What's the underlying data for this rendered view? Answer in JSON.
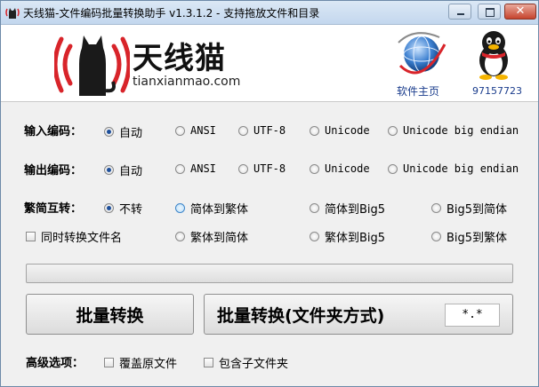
{
  "window": {
    "title": "天线猫-文件编码批量转换助手 v1.3.1.2 - 支持拖放文件和目录",
    "close_glyph": "✕"
  },
  "header": {
    "brand_name": "天线猫",
    "brand_url": "tianxianmao.com",
    "home_link": "软件主页",
    "qq_number": "97157723",
    "icons": [
      "cat-antenna-logo-icon",
      "globe-icon",
      "qq-penguin-icon"
    ]
  },
  "input_encoding": {
    "label": "输入编码：",
    "options": [
      "自动",
      "ANSI",
      "UTF-8",
      "Unicode",
      "Unicode big endian"
    ],
    "selected": "自动"
  },
  "output_encoding": {
    "label": "输出编码：",
    "options": [
      "自动",
      "ANSI",
      "UTF-8",
      "Unicode",
      "Unicode big endian"
    ],
    "selected": "自动"
  },
  "conversion": {
    "label": "繁简互转：",
    "options": [
      "不转",
      "简体到繁体",
      "简体到Big5",
      "Big5到简体",
      "繁体到简体",
      "繁体到Big5",
      "Big5到繁体"
    ],
    "selected": "不转",
    "convert_filename": {
      "label": "同时转换文件名",
      "checked": false
    }
  },
  "progress": {
    "value": 0
  },
  "actions": {
    "batch_convert": "批量转换",
    "batch_convert_folder": "批量转换(文件夹方式)",
    "file_mask": "*.*"
  },
  "advanced": {
    "label": "高级选项：",
    "overwrite": {
      "label": "覆盖原文件",
      "checked": false
    },
    "include_subfolders": {
      "label": "包含子文件夹",
      "checked": false
    }
  },
  "colors": {
    "accent": "#1e4f9a",
    "logo_red": "#d8242a",
    "link_blue": "#1a3c8c"
  }
}
